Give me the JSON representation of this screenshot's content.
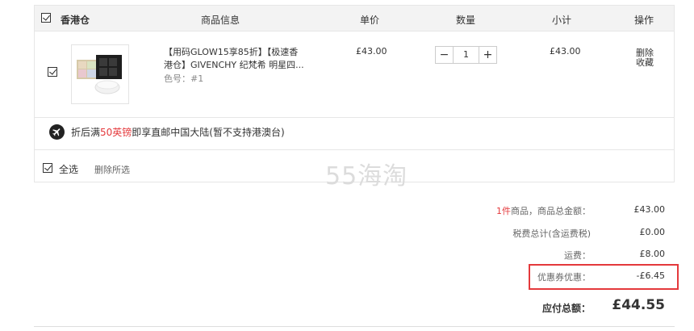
{
  "header": {
    "warehouse": "香港仓",
    "col_product": "商品信息",
    "col_price": "单价",
    "col_qty": "数量",
    "col_subtotal": "小计",
    "col_action": "操作"
  },
  "item": {
    "name": "【用码GLOW15享85折】【极速香港仓】GIVENCHY 纪梵希 明星四...",
    "spec": "色号：#1",
    "price": "£43.00",
    "qty": "1",
    "qty_minus": "−",
    "qty_plus": "+",
    "subtotal": "£43.00",
    "delete_label": "删除",
    "favorite_label": "收藏",
    "image_icon": "product-thumbnail"
  },
  "shipping": {
    "prefix": "折后满",
    "highlight": "50英镑",
    "suffix": "即享直邮中国大陆(暂不支持港澳台)",
    "icon": "plane-icon"
  },
  "footer": {
    "select_all": "全选",
    "delete_selected": "删除所选"
  },
  "watermark": "55海淘",
  "summary": {
    "count_highlight": "1件",
    "goods_label": "商品，商品总金额：",
    "goods_value": "£43.00",
    "tax_label": "税费总计(含运费税)",
    "tax_value": "£0.00",
    "shipping_label": "运费：",
    "shipping_value": "£8.00",
    "coupon_label": "优惠券优惠：",
    "coupon_value": "-£6.45",
    "total_label": "应付总额：",
    "total_value": "£44.55"
  },
  "colors": {
    "accent_red": "#e4393c",
    "header_bg": "#f3f3f3"
  }
}
